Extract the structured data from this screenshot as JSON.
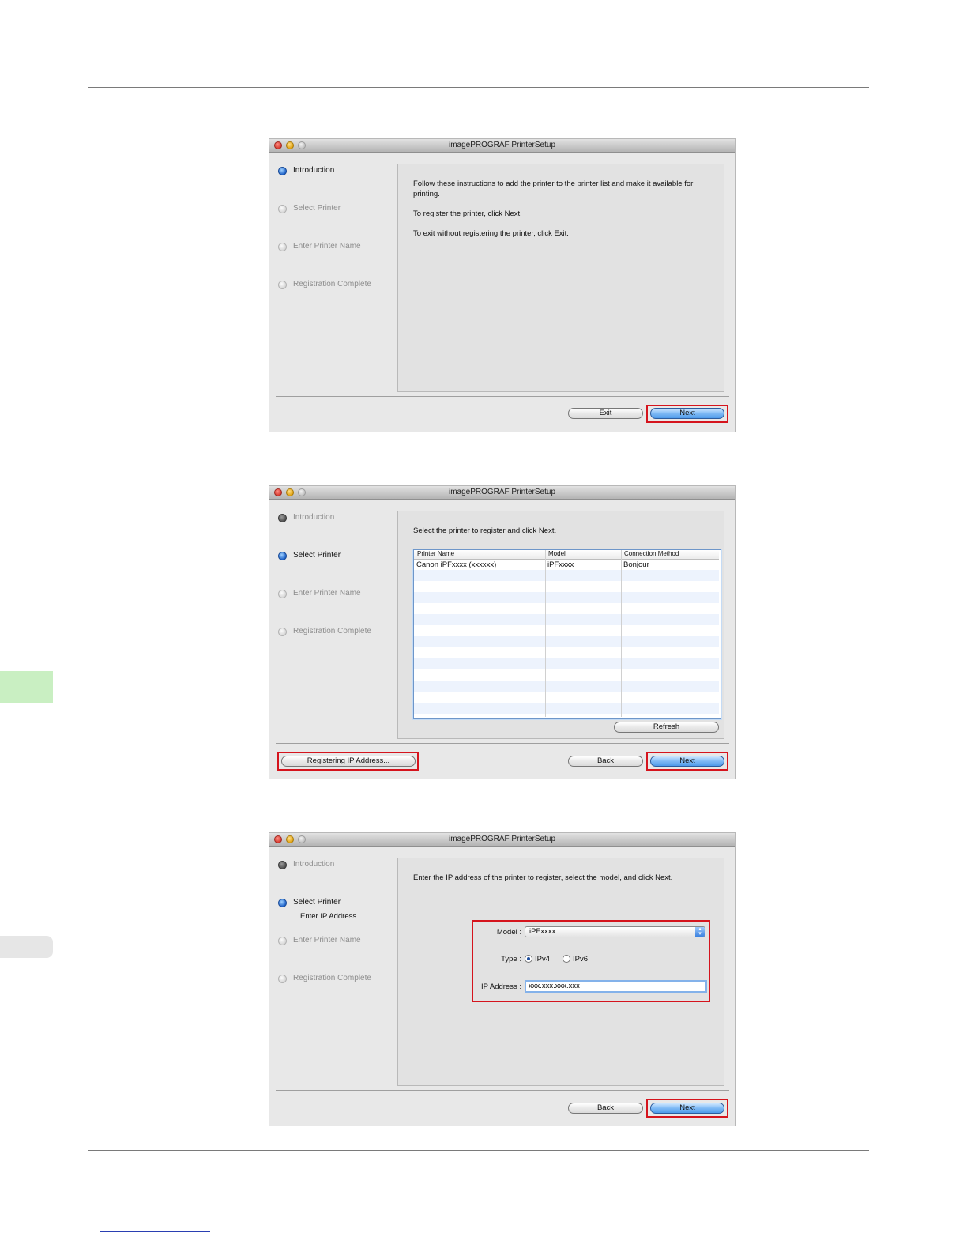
{
  "app_title": "imagePROGRAF PrinterSetup",
  "steps": {
    "introduction": "Introduction",
    "select_printer": "Select Printer",
    "enter_ip_address": "Enter IP Address",
    "enter_printer_name": "Enter Printer Name",
    "registration_complete": "Registration Complete"
  },
  "window1": {
    "line1": "Follow these instructions to add the printer to the printer list and make it available for printing.",
    "line2": "To register the printer, click Next.",
    "line3": "To exit without registering the printer, click Exit.",
    "exit_label": "Exit",
    "next_label": "Next"
  },
  "window2": {
    "instruction": "Select the printer to register and click Next.",
    "columns": [
      "Printer Name",
      "Model",
      "Connection Method"
    ],
    "rows": [
      {
        "printer_name": "Canon iPFxxxx (xxxxxx)",
        "model": "iPFxxxx",
        "connection_method": "Bonjour"
      }
    ],
    "refresh_label": "Refresh",
    "register_ip_label": "Registering IP Address...",
    "back_label": "Back",
    "next_label": "Next"
  },
  "window3": {
    "instruction": "Enter the IP address of the printer to register, select the model, and click Next.",
    "model_label": "Model :",
    "model_value": "iPFxxxx",
    "type_label": "Type :",
    "ipv4_label": "IPv4",
    "ipv6_label": "IPv6",
    "selected_type": "IPv4",
    "ip_label": "IP Address :",
    "ip_value": "xxx.xxx.xxx.xxx",
    "back_label": "Back",
    "next_label": "Next"
  },
  "colors": {
    "highlight": "#d5141d",
    "side_tab": "#c9efc2",
    "default_button": "#7fbaf5"
  }
}
